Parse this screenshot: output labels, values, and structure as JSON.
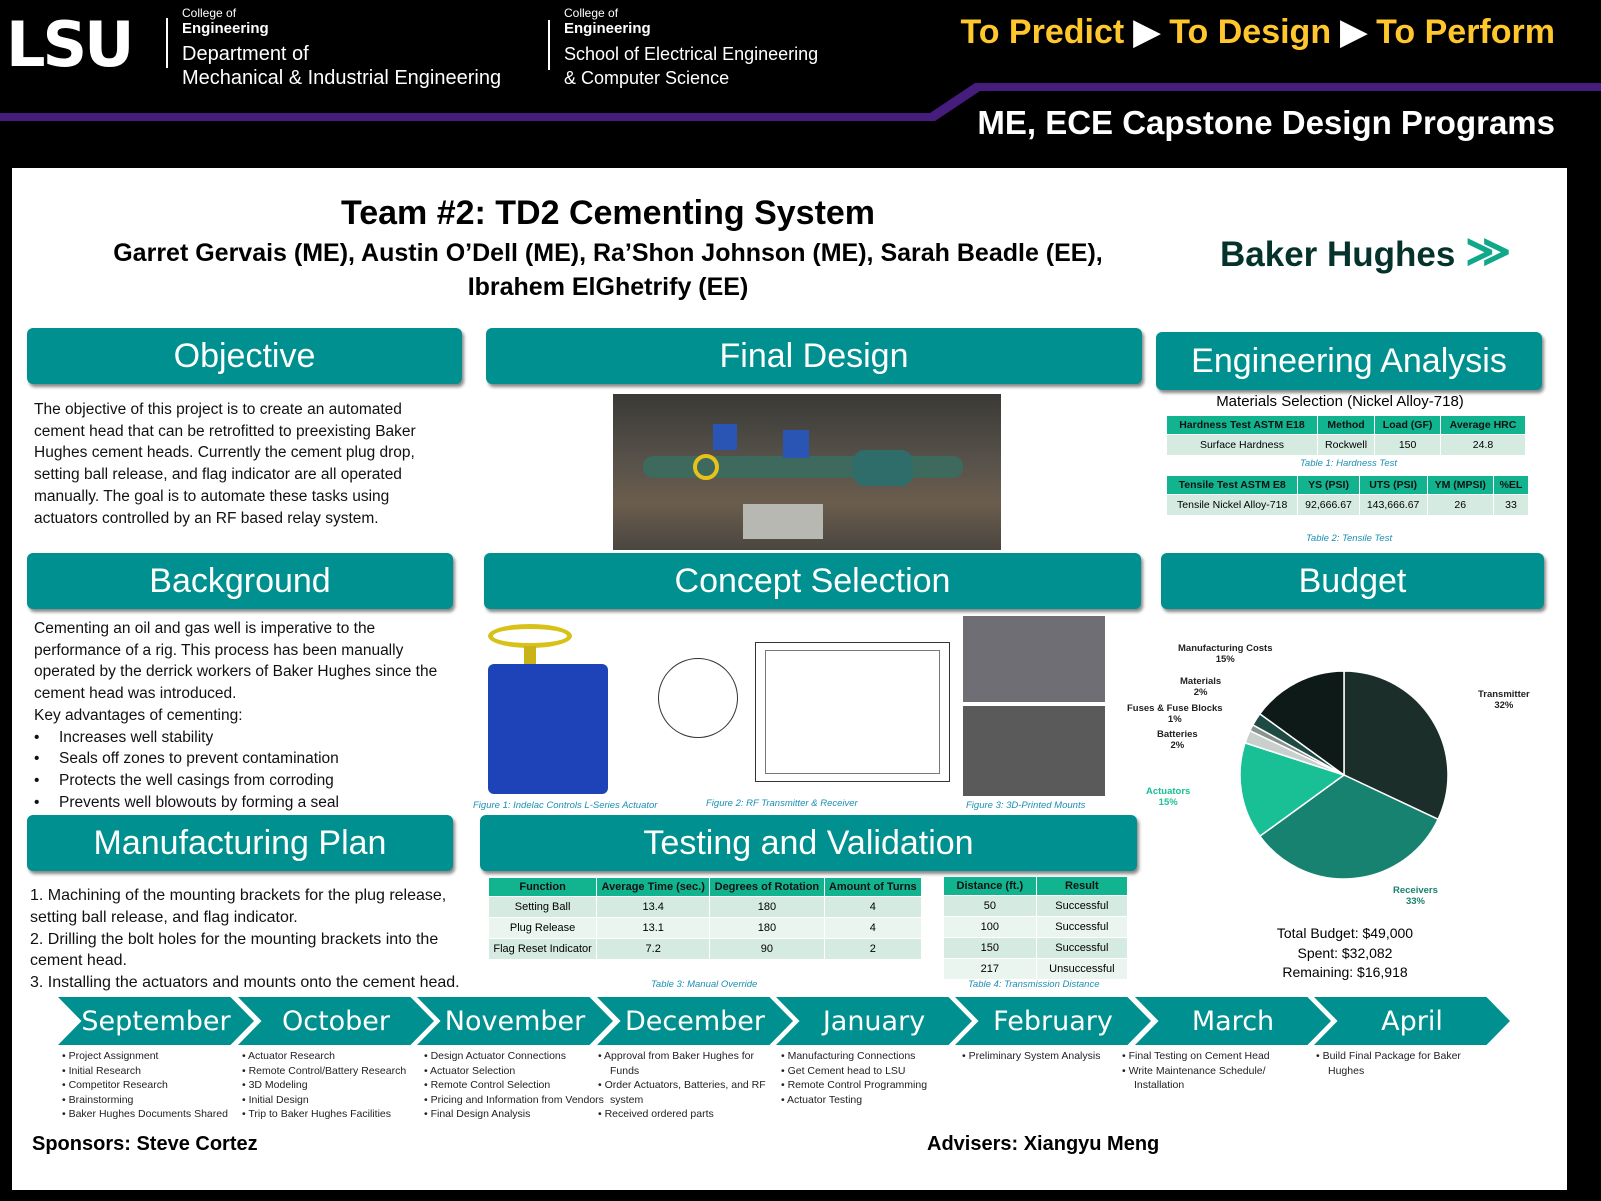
{
  "header": {
    "logo": "LSU",
    "college1": "College of",
    "college2": "Engineering",
    "dept1_line1": "Department of",
    "dept1_line2": "Mechanical & Industrial Engineering",
    "college3": "College of",
    "college4": "Engineering",
    "dept2_line1": "School of Electrical Engineering",
    "dept2_line2": "& Computer Science",
    "tagline": [
      "To Predict",
      "To Design",
      "To Perform"
    ],
    "program": "ME, ECE Capstone Design Programs",
    "accent": "#ffc72c",
    "purple": "#461d7c"
  },
  "title": "Team #2: TD2 Cementing System",
  "members_line1": "Garret Gervais (ME), Austin O’Dell (ME), Ra’Shon Johnson (ME), Sarah Beadle (EE),",
  "members_line2": "Ibrahem ElGhetrify (EE)",
  "sponsor_logo": "Baker Hughes",
  "objective": {
    "title": "Objective",
    "text": "The objective of this project is to create an automated cement head that can be retrofitted to preexisting Baker Hughes cement heads. Currently the cement plug drop, setting ball release, and flag indicator are all operated manually. The goal is to automate these tasks using actuators controlled by an RF based relay system."
  },
  "background": {
    "title": "Background",
    "text": "Cementing an oil and gas well is imperative to the performance of a rig. This process has been manually operated by the derrick workers of Baker Hughes since the cement head was introduced.",
    "key": "Key advantages of cementing:",
    "bullets": [
      "Increases well stability",
      "Seals off zones to prevent contamination",
      "Protects the well casings from corroding",
      "Prevents well blowouts by forming a seal"
    ]
  },
  "manufacturing": {
    "title": "Manufacturing Plan",
    "steps": [
      "1. Machining of the mounting brackets for the plug release, setting ball release, and flag indicator.",
      "2. Drilling the bolt holes for the mounting brackets into the cement head.",
      "3. Installing the actuators and mounts onto the cement head."
    ]
  },
  "final_design": {
    "title": "Final Design"
  },
  "concept": {
    "title": "Concept Selection",
    "captions": [
      "Figure 1: Indelac Controls L-Series Actuator",
      "Figure 2: RF Transmitter & Receiver",
      "Figure 3: 3D-Printed Mounts"
    ]
  },
  "testing": {
    "title": "Testing and Validation",
    "table3": {
      "headers": [
        "Function",
        "Average Time (sec.)",
        "Degrees of Rotation",
        "Amount of Turns"
      ],
      "rows": [
        [
          "Setting Ball",
          "13.4",
          "180",
          "4"
        ],
        [
          "Plug Release",
          "13.1",
          "180",
          "4"
        ],
        [
          "Flag Reset Indicator",
          "7.2",
          "90",
          "2"
        ]
      ],
      "caption": "Table 3: Manual Override"
    },
    "table4": {
      "headers": [
        "Distance (ft.)",
        "Result"
      ],
      "rows": [
        [
          "50",
          "Successful"
        ],
        [
          "100",
          "Successful"
        ],
        [
          "150",
          "Successful"
        ],
        [
          "217",
          "Unsuccessful"
        ]
      ],
      "caption": "Table 4: Transmission Distance"
    }
  },
  "analysis": {
    "title": "Engineering Analysis",
    "subtitle": "Materials Selection (Nickel Alloy-718)",
    "table1": {
      "headers": [
        "Hardness Test ASTM E18",
        "Method",
        "Load (GF)",
        "Average HRC"
      ],
      "rows": [
        [
          "Surface Hardness",
          "Rockwell",
          "150",
          "24.8"
        ]
      ],
      "caption": "Table 1: Hardness Test"
    },
    "table2": {
      "headers": [
        "Tensile Test ASTM E8",
        "YS (PSI)",
        "UTS (PSI)",
        "YM (MPSI)",
        "%EL"
      ],
      "rows": [
        [
          "Tensile Nickel Alloy-718",
          "92,666.67",
          "143,666.67",
          "26",
          "33"
        ]
      ],
      "caption": "Table 2: Tensile Test"
    }
  },
  "budget": {
    "title": "Budget",
    "total": "Total Budget: $49,000",
    "spent": "Spent: $32,082",
    "remaining": "Remaining: $16,918"
  },
  "chart_data": {
    "type": "pie",
    "slices": [
      {
        "label": "Transmitter",
        "value": 32,
        "color": "#1b2e2a"
      },
      {
        "label": "Receivers",
        "value": 33,
        "color": "#16826f"
      },
      {
        "label": "Actuators",
        "value": 15,
        "color": "#19bf95"
      },
      {
        "label": "Batteries",
        "value": 2,
        "color": "#c9cfcd"
      },
      {
        "label": "Fuses & Fuse Blocks",
        "value": 1,
        "color": "#8a9390"
      },
      {
        "label": "Materials",
        "value": 2,
        "color": "#1f4a44"
      },
      {
        "label": "Manufacturing Costs",
        "value": 15,
        "color": "#0e1a18"
      }
    ]
  },
  "timeline": [
    {
      "month": "September",
      "items": [
        "Project Assignment",
        "Initial Research",
        "Competitor Research",
        "Brainstorming",
        "Baker Hughes Documents Shared"
      ]
    },
    {
      "month": "October",
      "items": [
        "Actuator Research",
        "Remote Control/Battery Research",
        "3D Modeling",
        "Initial Design",
        "Trip to Baker Hughes Facilities"
      ]
    },
    {
      "month": "November",
      "items": [
        "Design Actuator Connections",
        "Actuator Selection",
        "Remote Control Selection",
        "Pricing and Information from Vendors",
        "Final Design Analysis"
      ]
    },
    {
      "month": "December",
      "items": [
        "Approval from Baker Hughes for Funds",
        "Order Actuators, Batteries, and RF system",
        "Received ordered parts"
      ]
    },
    {
      "month": "January",
      "items": [
        "Manufacturing Connections",
        "Get Cement head to LSU",
        "Remote Control Programming",
        "Actuator Testing"
      ]
    },
    {
      "month": "February",
      "items": [
        "Preliminary System Analysis"
      ]
    },
    {
      "month": "March",
      "items": [
        "Final Testing on Cement Head",
        "Write Maintenance Schedule/ Installation"
      ]
    },
    {
      "month": "April",
      "items": [
        "Build Final Package for Baker Hughes"
      ]
    }
  ],
  "sponsors": "Sponsors: Steve Cortez",
  "advisers": "Advisers: Xiangyu Meng"
}
